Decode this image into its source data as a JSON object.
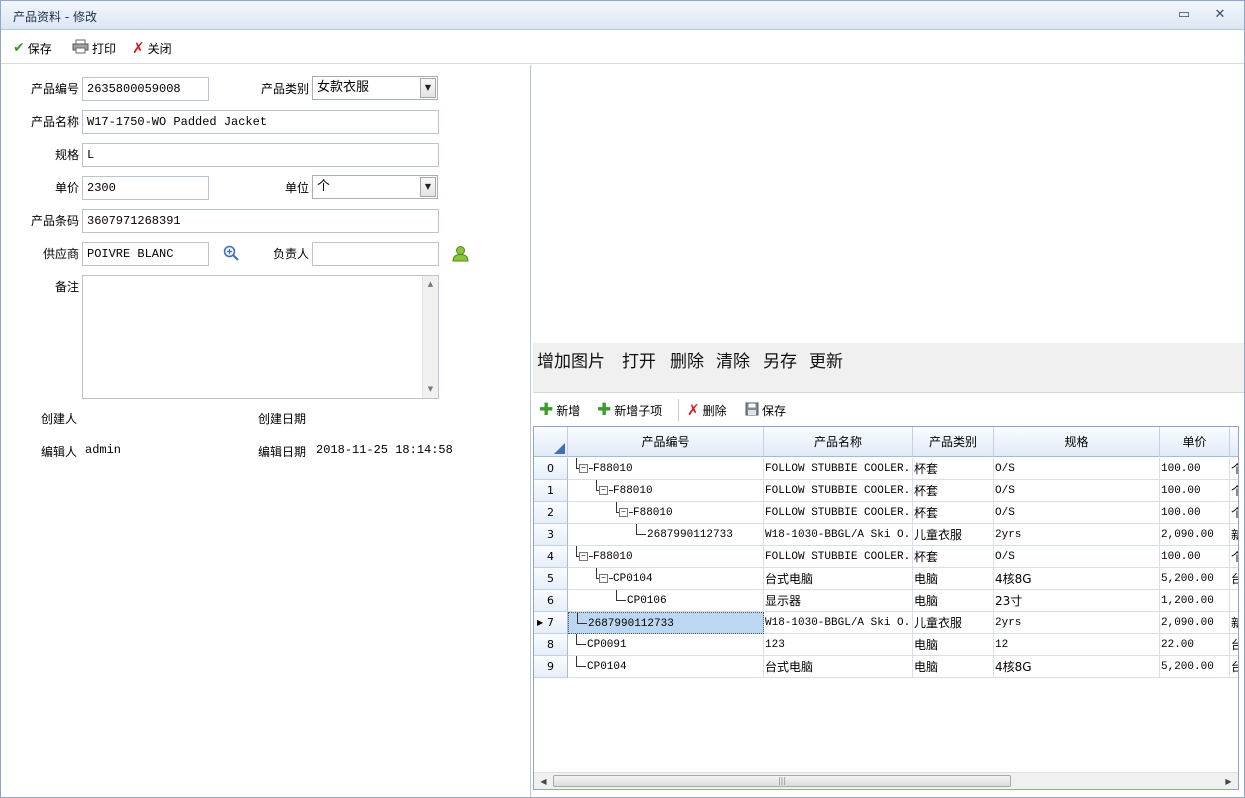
{
  "window": {
    "title": "产品资料 - 修改",
    "min_glyph": "▭",
    "close_glyph": "✕"
  },
  "toolbar": {
    "save": "保存",
    "print": "打印",
    "close": "关闭"
  },
  "form": {
    "code_label": "产品编号",
    "code_value": "2635800059008",
    "category_label": "产品类别",
    "category_value": "女款衣服",
    "name_label": "产品名称",
    "name_value": "W17-1750-WO Padded Jacket",
    "spec_label": "规格",
    "spec_value": "L",
    "price_label": "单价",
    "price_value": "2300",
    "unit_label": "单位",
    "unit_value": "个",
    "barcode_label": "产品条码",
    "barcode_value": "3607971268391",
    "supplier_label": "供应商",
    "supplier_value": "POIVRE BLANC",
    "owner_label": "负责人",
    "owner_value": "",
    "remark_label": "备注",
    "creator_label": "创建人",
    "creator_value": "",
    "created_label": "创建日期",
    "created_value": "",
    "editor_label": "编辑人",
    "editor_value": "admin",
    "edited_label": "编辑日期",
    "edited_value": "2018-11-25 18:14:58"
  },
  "image_actions": {
    "add": "增加图片",
    "open": "打开",
    "delete": "删除",
    "clear": "清除",
    "save_as": "另存",
    "update": "更新"
  },
  "grid_toolbar": {
    "add": "新增",
    "add_child": "新增子项",
    "delete": "删除",
    "save": "保存"
  },
  "grid": {
    "columns": [
      "产品编号",
      "产品名称",
      "产品类别",
      "规格",
      "单价"
    ],
    "rows": [
      {
        "idx": "0",
        "code": "F88010",
        "name": "FOLLOW STUBBIE COOLER...",
        "cat": "杯套",
        "spec": "O/S",
        "price": "100.00",
        "extra": "个",
        "level": 0,
        "expander": "⊟"
      },
      {
        "idx": "1",
        "code": "F88010",
        "name": "FOLLOW STUBBIE COOLER...",
        "cat": "杯套",
        "spec": "O/S",
        "price": "100.00",
        "extra": "个",
        "level": 1,
        "expander": "⊟"
      },
      {
        "idx": "2",
        "code": "F88010",
        "name": "FOLLOW STUBBIE COOLER...",
        "cat": "杯套",
        "spec": "O/S",
        "price": "100.00",
        "extra": "个",
        "level": 2,
        "expander": "⊟"
      },
      {
        "idx": "3",
        "code": "2687990112733",
        "name": "W18-1030-BBGL/A Ski O...",
        "cat": "儿童衣服",
        "spec": "2yrs",
        "price": "2,090.00",
        "extra": "新",
        "level": 3,
        "expander": ""
      },
      {
        "idx": "4",
        "code": "F88010",
        "name": "FOLLOW STUBBIE COOLER...",
        "cat": "杯套",
        "spec": "O/S",
        "price": "100.00",
        "extra": "个",
        "level": 0,
        "expander": "⊟"
      },
      {
        "idx": "5",
        "code": "CP0104",
        "name": "台式电脑",
        "cat": "电脑",
        "spec": "4核8G",
        "price": "5,200.00",
        "extra": "台",
        "level": 1,
        "expander": "⊟"
      },
      {
        "idx": "6",
        "code": "CP0106",
        "name": "显示器",
        "cat": "电脑",
        "spec": "23寸",
        "price": "1,200.00",
        "extra": "",
        "level": 2,
        "expander": ""
      },
      {
        "idx": "7",
        "code": "2687990112733",
        "name": "W18-1030-BBGL/A Ski O...",
        "cat": "儿童衣服",
        "spec": "2yrs",
        "price": "2,090.00",
        "extra": "新",
        "level": 0,
        "expander": "",
        "selected": true,
        "current_marker": "▶"
      },
      {
        "idx": "8",
        "code": "CP0091",
        "name": "123",
        "cat": "电脑",
        "spec": "12",
        "price": "22.00",
        "extra": "台",
        "level": 0,
        "expander": ""
      },
      {
        "idx": "9",
        "code": "CP0104",
        "name": "台式电脑",
        "cat": "电脑",
        "spec": "4核8G",
        "price": "5,200.00",
        "extra": "台",
        "level": 0,
        "expander": ""
      }
    ]
  },
  "colors": {
    "accent": "#4a7fc1",
    "selection": "#bcd7f2",
    "save_green": "#3a9a2a",
    "close_red": "#d02020"
  }
}
